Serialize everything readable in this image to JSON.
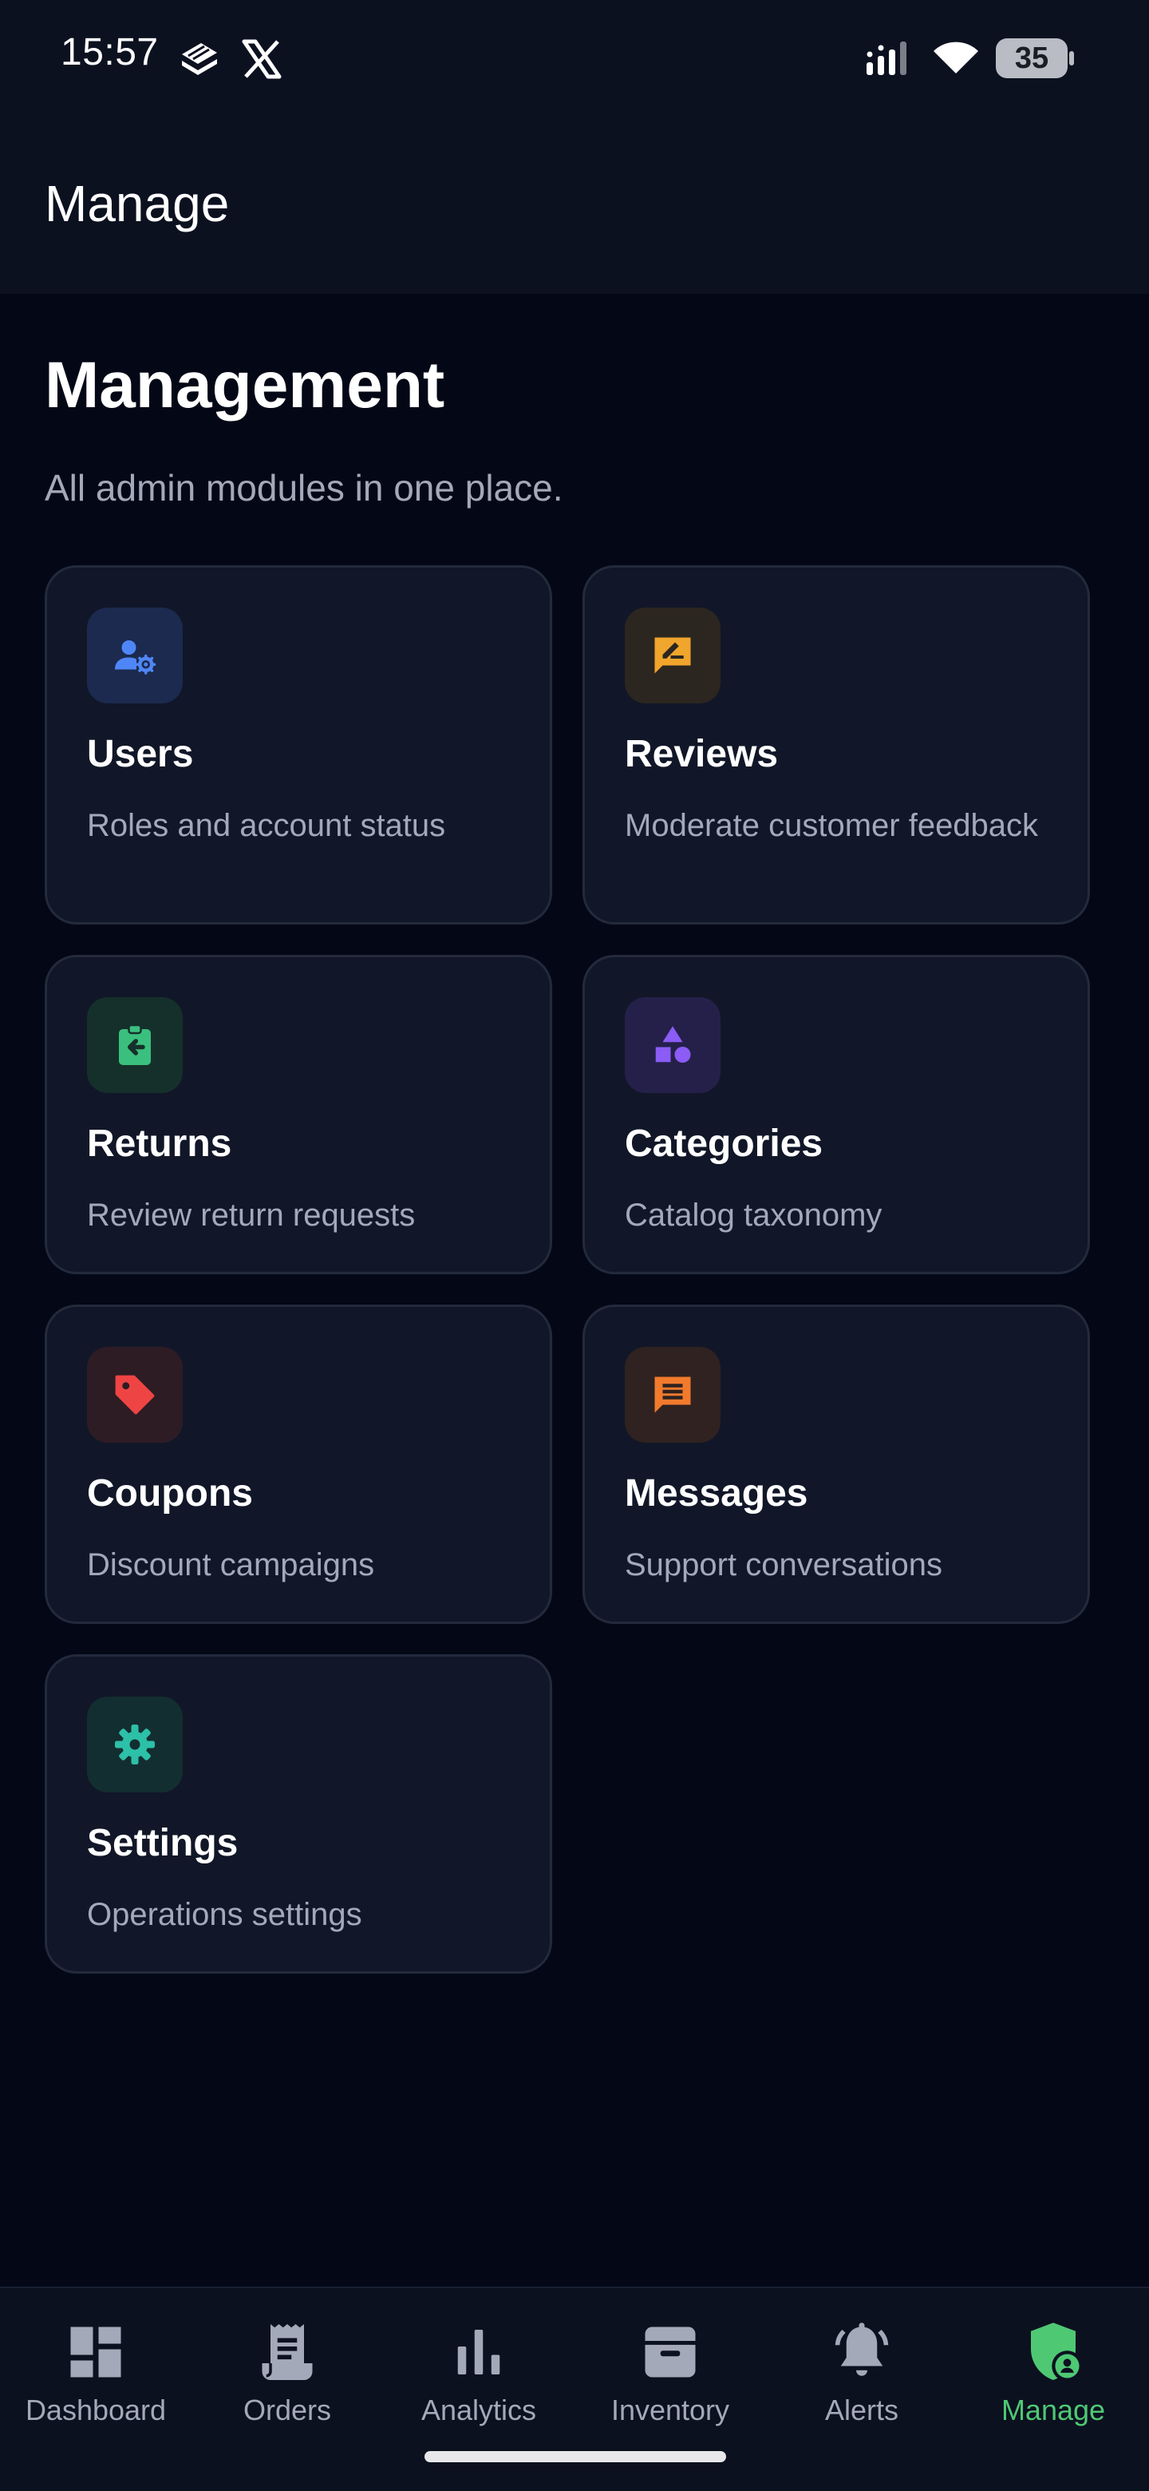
{
  "status_bar": {
    "time": "15:57",
    "battery": "35",
    "icons": [
      "stack-app-icon",
      "x-app-icon",
      "signal-icon",
      "wifi-icon",
      "battery-icon"
    ]
  },
  "app_bar": {
    "title": "Manage"
  },
  "main": {
    "heading": "Management",
    "subtitle": "All admin modules in one place.",
    "cards": [
      {
        "title": "Users",
        "desc": "Roles and account status",
        "icon": "manage-accounts-icon",
        "icon_color": "#4f86f7",
        "icon_bg": "#1b2a4e"
      },
      {
        "title": "Reviews",
        "desc": "Moderate customer feedback",
        "icon": "rate-review-icon",
        "icon_color": "#f0a52c",
        "icon_bg": "#2c2620"
      },
      {
        "title": "Returns",
        "desc": "Review return requests",
        "icon": "assignment-return-icon",
        "icon_color": "#3bbf7f",
        "icon_bg": "#15302a"
      },
      {
        "title": "Categories",
        "desc": "Catalog taxonomy",
        "icon": "category-icon",
        "icon_color": "#8b5cf6",
        "icon_bg": "#25204a"
      },
      {
        "title": "Coupons",
        "desc": "Discount campaigns",
        "icon": "tag-icon",
        "icon_color": "#ef4444",
        "icon_bg": "#2e1c24"
      },
      {
        "title": "Messages",
        "desc": "Support conversations",
        "icon": "chat-icon",
        "icon_color": "#f27a2c",
        "icon_bg": "#2f2220"
      },
      {
        "title": "Settings",
        "desc": "Operations settings",
        "icon": "gear-icon",
        "icon_color": "#2dc0a8",
        "icon_bg": "#132e30"
      }
    ]
  },
  "bottom_nav": {
    "active": "Manage",
    "active_color": "#4fc873",
    "items": [
      {
        "label": "Dashboard",
        "icon": "dashboard-icon"
      },
      {
        "label": "Orders",
        "icon": "receipt-icon"
      },
      {
        "label": "Analytics",
        "icon": "bar-chart-icon"
      },
      {
        "label": "Inventory",
        "icon": "archive-box-icon"
      },
      {
        "label": "Alerts",
        "icon": "bell-icon"
      },
      {
        "label": "Manage",
        "icon": "admin-shield-icon"
      }
    ]
  }
}
